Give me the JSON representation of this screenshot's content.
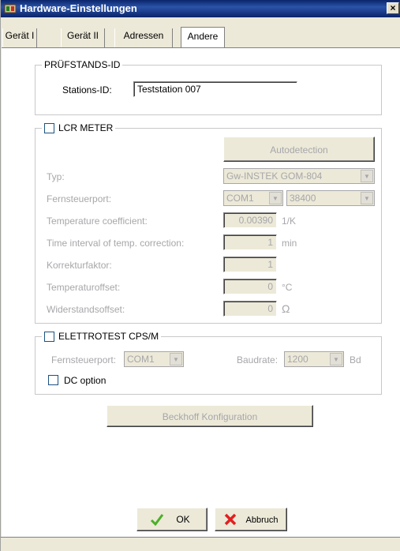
{
  "window": {
    "title": "Hardware-Einstellungen",
    "close_label": "×"
  },
  "tabs": [
    {
      "label": "Gerät I"
    },
    {
      "label": "Gerät II"
    },
    {
      "label": "Adressen"
    },
    {
      "label": "Andere"
    }
  ],
  "pruefstand": {
    "group_title": "PRÜFSTANDS-ID",
    "station_label": "Stations-ID:",
    "station_value": "Teststation 007"
  },
  "lcr": {
    "group_title": "LCR METER",
    "autodetect_label": "Autodetection",
    "type_label": "Typ:",
    "type_value": "Gw-INSTEK GOM-804",
    "port_label": "Fernsteuerport:",
    "port_value": "COM1",
    "baud_value": "38400",
    "tempcoef_label": "Temperature coefficient:",
    "tempcoef_value": "0.00390",
    "tempcoef_unit": "1/K",
    "interval_label": "Time interval of temp. correction:",
    "interval_value": "1",
    "interval_unit": "min",
    "korr_label": "Korrekturfaktor:",
    "korr_value": "1",
    "tempoff_label": "Temperaturoffset:",
    "tempoff_value": "0",
    "tempoff_unit": "°C",
    "resoff_label": "Widerstandsoffset:",
    "resoff_value": "0",
    "resoff_unit": "Ω"
  },
  "elettrotest": {
    "group_title": "ELETTROTEST CPS/M",
    "port_label": "Fernsteuerport:",
    "port_value": "COM1",
    "baud_label": "Baudrate:",
    "baud_value": "1200",
    "baud_unit": "Bd",
    "dc_label": "DC option"
  },
  "beckhoff_label": "Beckhoff Konfiguration",
  "ok_label": "OK",
  "cancel_label": "Abbruch",
  "colors": {
    "title_bar": "#0a246a",
    "ok_check": "#4caf2a",
    "cancel_x": "#e02020"
  }
}
